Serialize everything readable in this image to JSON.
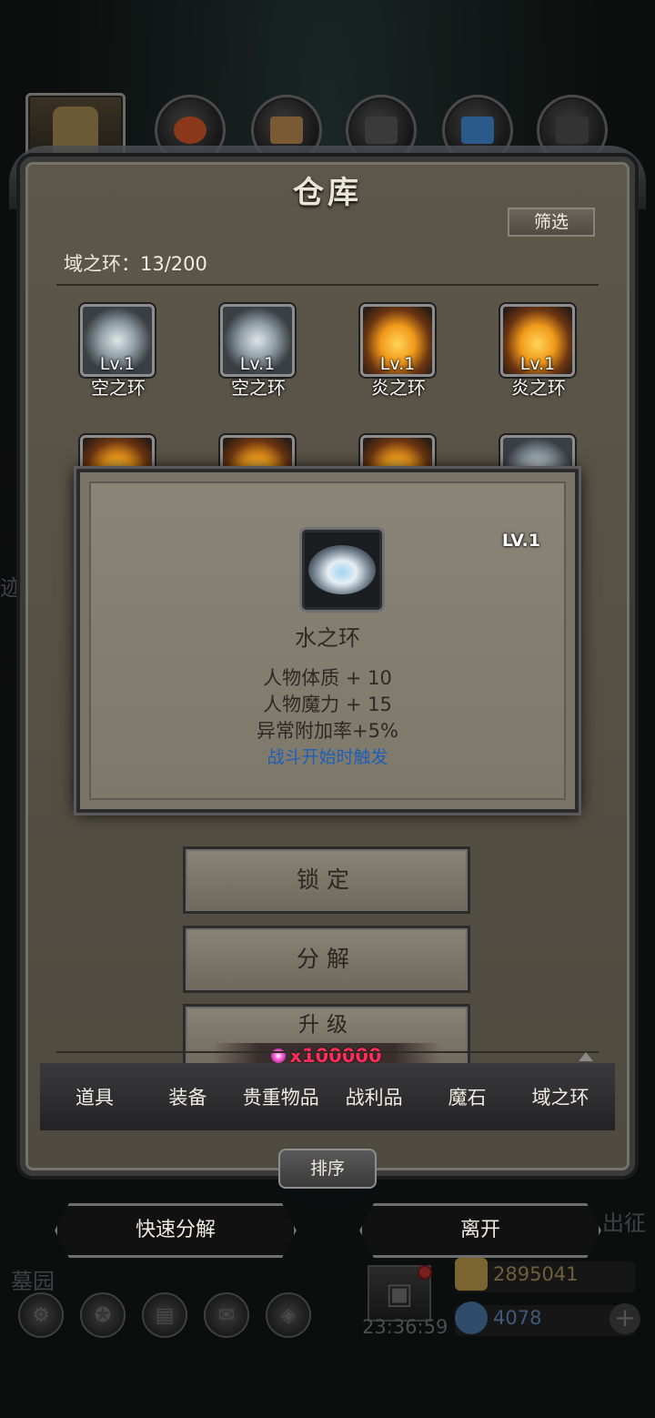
{
  "window": {
    "title": "仓库"
  },
  "filter_label": "筛选",
  "count_label": "域之环：13/200",
  "top_icons": [
    {
      "name": "character-icon"
    },
    {
      "name": "potion-icon"
    },
    {
      "name": "chest-icon"
    },
    {
      "name": "ore-icon"
    },
    {
      "name": "crystal-icon"
    },
    {
      "name": "anvil-icon"
    }
  ],
  "grid_items": [
    {
      "level": "Lv.1",
      "name": "空之环",
      "type": "sky"
    },
    {
      "level": "Lv.1",
      "name": "空之环",
      "type": "sky"
    },
    {
      "level": "Lv.1",
      "name": "炎之环",
      "type": "fire"
    },
    {
      "level": "Lv.1",
      "name": "炎之环",
      "type": "fire"
    }
  ],
  "popup": {
    "level": "LV.1",
    "item_name": "水之环",
    "stats": [
      "人物体质 + 10",
      "人物魔力 + 15",
      "异常附加率+5%"
    ],
    "trigger": "战斗开始时触发"
  },
  "actions": {
    "lock_label": "锁定",
    "decompose_label": "分解",
    "upgrade_label": "升级",
    "upgrade_cost": "x100000"
  },
  "tabs": [
    "道具",
    "装备",
    "贵重物品",
    "战利品",
    "魔石",
    "域之环"
  ],
  "sort_label": "排序",
  "quick_decompose_label": "快速分解",
  "leave_label": "离开",
  "background": {
    "left_text": "迹",
    "right_text": "出征",
    "graveyard_text": "墓园",
    "timer": "23:36:59",
    "gold": "2895041",
    "gems": "4078",
    "colors": {
      "gold": "#7a6530",
      "gem": "#2f4d6b"
    }
  }
}
